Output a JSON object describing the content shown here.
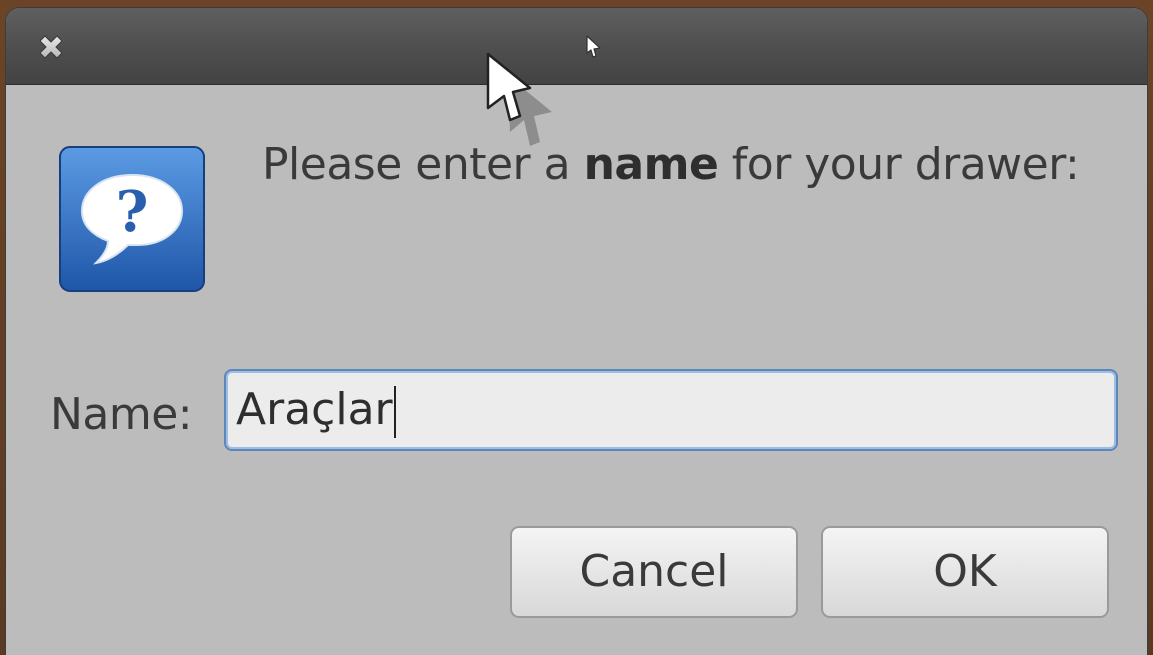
{
  "dialog": {
    "close_icon": "close-icon",
    "icon": "question-icon",
    "prompt_prefix": "Please enter a ",
    "prompt_bold": "name",
    "prompt_suffix": " for your drawer:",
    "name_label": "Name:",
    "name_value": "Araçlar",
    "cancel_label": "Cancel",
    "ok_label": "OK"
  },
  "colors": {
    "titlebar": "#4e4e4e",
    "body": "#bcbcbc",
    "input_focus": "#5f86b8",
    "icon_blue": "#2f6fc4"
  }
}
